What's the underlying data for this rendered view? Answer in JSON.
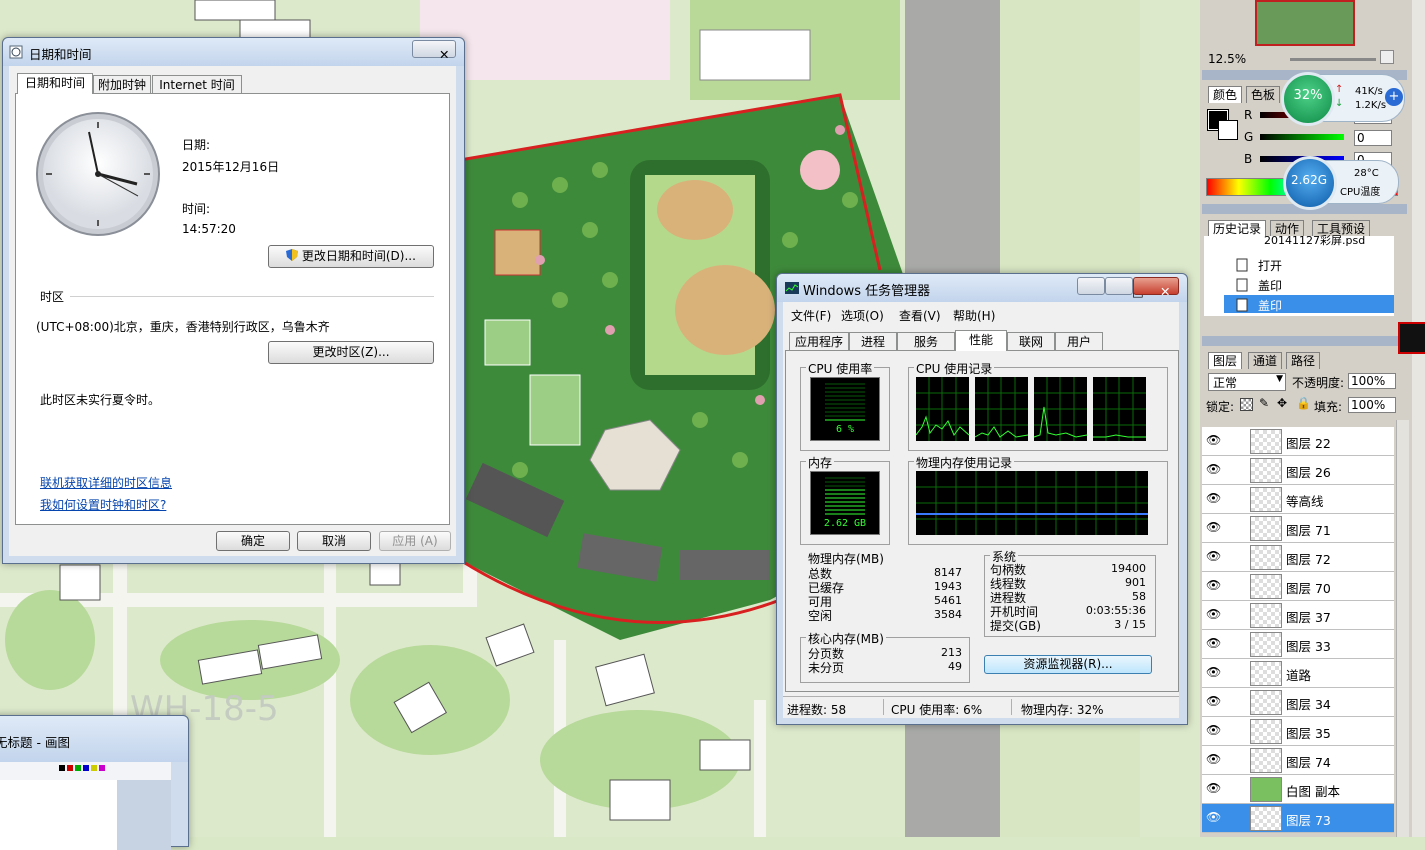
{
  "datetime_dialog": {
    "title": "日期和时间",
    "tabs": [
      "日期和时间",
      "附加时钟",
      "Internet 时间"
    ],
    "date_label": "日期:",
    "date_value": "2015年12月16日",
    "time_label": "时间:",
    "time_value": "14:57:20",
    "change_datetime_button": "更改日期和时间(D)...",
    "timezone_heading": "时区",
    "timezone_value": "(UTC+08:00)北京，重庆，香港特别行政区，乌鲁木齐",
    "change_timezone_button": "更改时区(Z)...",
    "dst_note": "此时区未实行夏令时。",
    "link_timezone_info": "联机获取详细的时区信息",
    "link_how_to": "我如何设置时钟和时区?",
    "ok_button": "确定",
    "cancel_button": "取消",
    "apply_button": "应用 (A)",
    "close_glyph": "✕"
  },
  "task_manager": {
    "title": "Windows 任务管理器",
    "menu": [
      "文件(F)",
      "选项(O)",
      "查看(V)",
      "帮助(H)"
    ],
    "tabs": [
      "应用程序",
      "进程",
      "服务",
      "性能",
      "联网",
      "用户"
    ],
    "active_tab": "性能",
    "cpu_usage_label": "CPU 使用率",
    "cpu_usage_value": "6 %",
    "cpu_history_label": "CPU 使用记录",
    "memory_label": "内存",
    "memory_value": "2.62 GB",
    "memory_history_label": "物理内存使用记录",
    "physical_memory": {
      "heading": "物理内存(MB)",
      "rows": [
        {
          "label": "总数",
          "value": "8147"
        },
        {
          "label": "已缓存",
          "value": "1943"
        },
        {
          "label": "可用",
          "value": "5461"
        },
        {
          "label": "空闲",
          "value": "3584"
        }
      ]
    },
    "kernel_memory": {
      "heading": "核心内存(MB)",
      "rows": [
        {
          "label": "分页数",
          "value": "213"
        },
        {
          "label": "未分页",
          "value": "49"
        }
      ]
    },
    "system": {
      "heading": "系统",
      "rows": [
        {
          "label": "句柄数",
          "value": "19400"
        },
        {
          "label": "线程数",
          "value": "901"
        },
        {
          "label": "进程数",
          "value": "58"
        },
        {
          "label": "开机时间",
          "value": "0:03:55:36"
        },
        {
          "label": "提交(GB)",
          "value": "3 / 15"
        }
      ]
    },
    "resource_monitor_button": "资源监视器(R)...",
    "status": {
      "processes": "进程数: 58",
      "cpu": "CPU 使用率: 6%",
      "memory": "物理内存: 32%"
    },
    "window_buttons": [
      "－",
      "□",
      "✕"
    ]
  },
  "paint_window": {
    "title": "无标题 - 画图"
  },
  "map_labels": [
    "WH-18-5"
  ],
  "photoshop": {
    "navigator_zoom": "12.5%",
    "color_tabs": [
      "颜色",
      "色板"
    ],
    "channels": [
      {
        "label": "R",
        "value": "0"
      },
      {
        "label": "G",
        "value": "0"
      },
      {
        "label": "B",
        "value": "0"
      }
    ],
    "history_tabs": [
      "历史记录",
      "动作",
      "工具预设"
    ],
    "history_snapshot": "20141127彩屏.psd",
    "history_items": [
      "打开",
      "盖印",
      "盖印"
    ],
    "layers_tabs": [
      "图层",
      "通道",
      "路径"
    ],
    "blend_mode": "正常",
    "opacity_label": "不透明度:",
    "opacity_value": "100%",
    "lock_label": "锁定:",
    "fill_label": "填充:",
    "fill_value": "100%",
    "layers": [
      "图层 22",
      "图层 26",
      "等高线",
      "图层 71",
      "图层 72",
      "图层 70",
      "图层 37",
      "图层 33",
      "道路",
      "图层 34",
      "图层 35",
      "图层 74",
      "白图 副本",
      "图层 73"
    ],
    "selected_layer": "图层 73"
  },
  "net_widget": {
    "percent": "32%",
    "up_speed": "41K/s",
    "down_speed": "1.2K/s",
    "memory_value": "2.62G",
    "temperature": "28°C",
    "temperature_label": "CPU温度"
  }
}
